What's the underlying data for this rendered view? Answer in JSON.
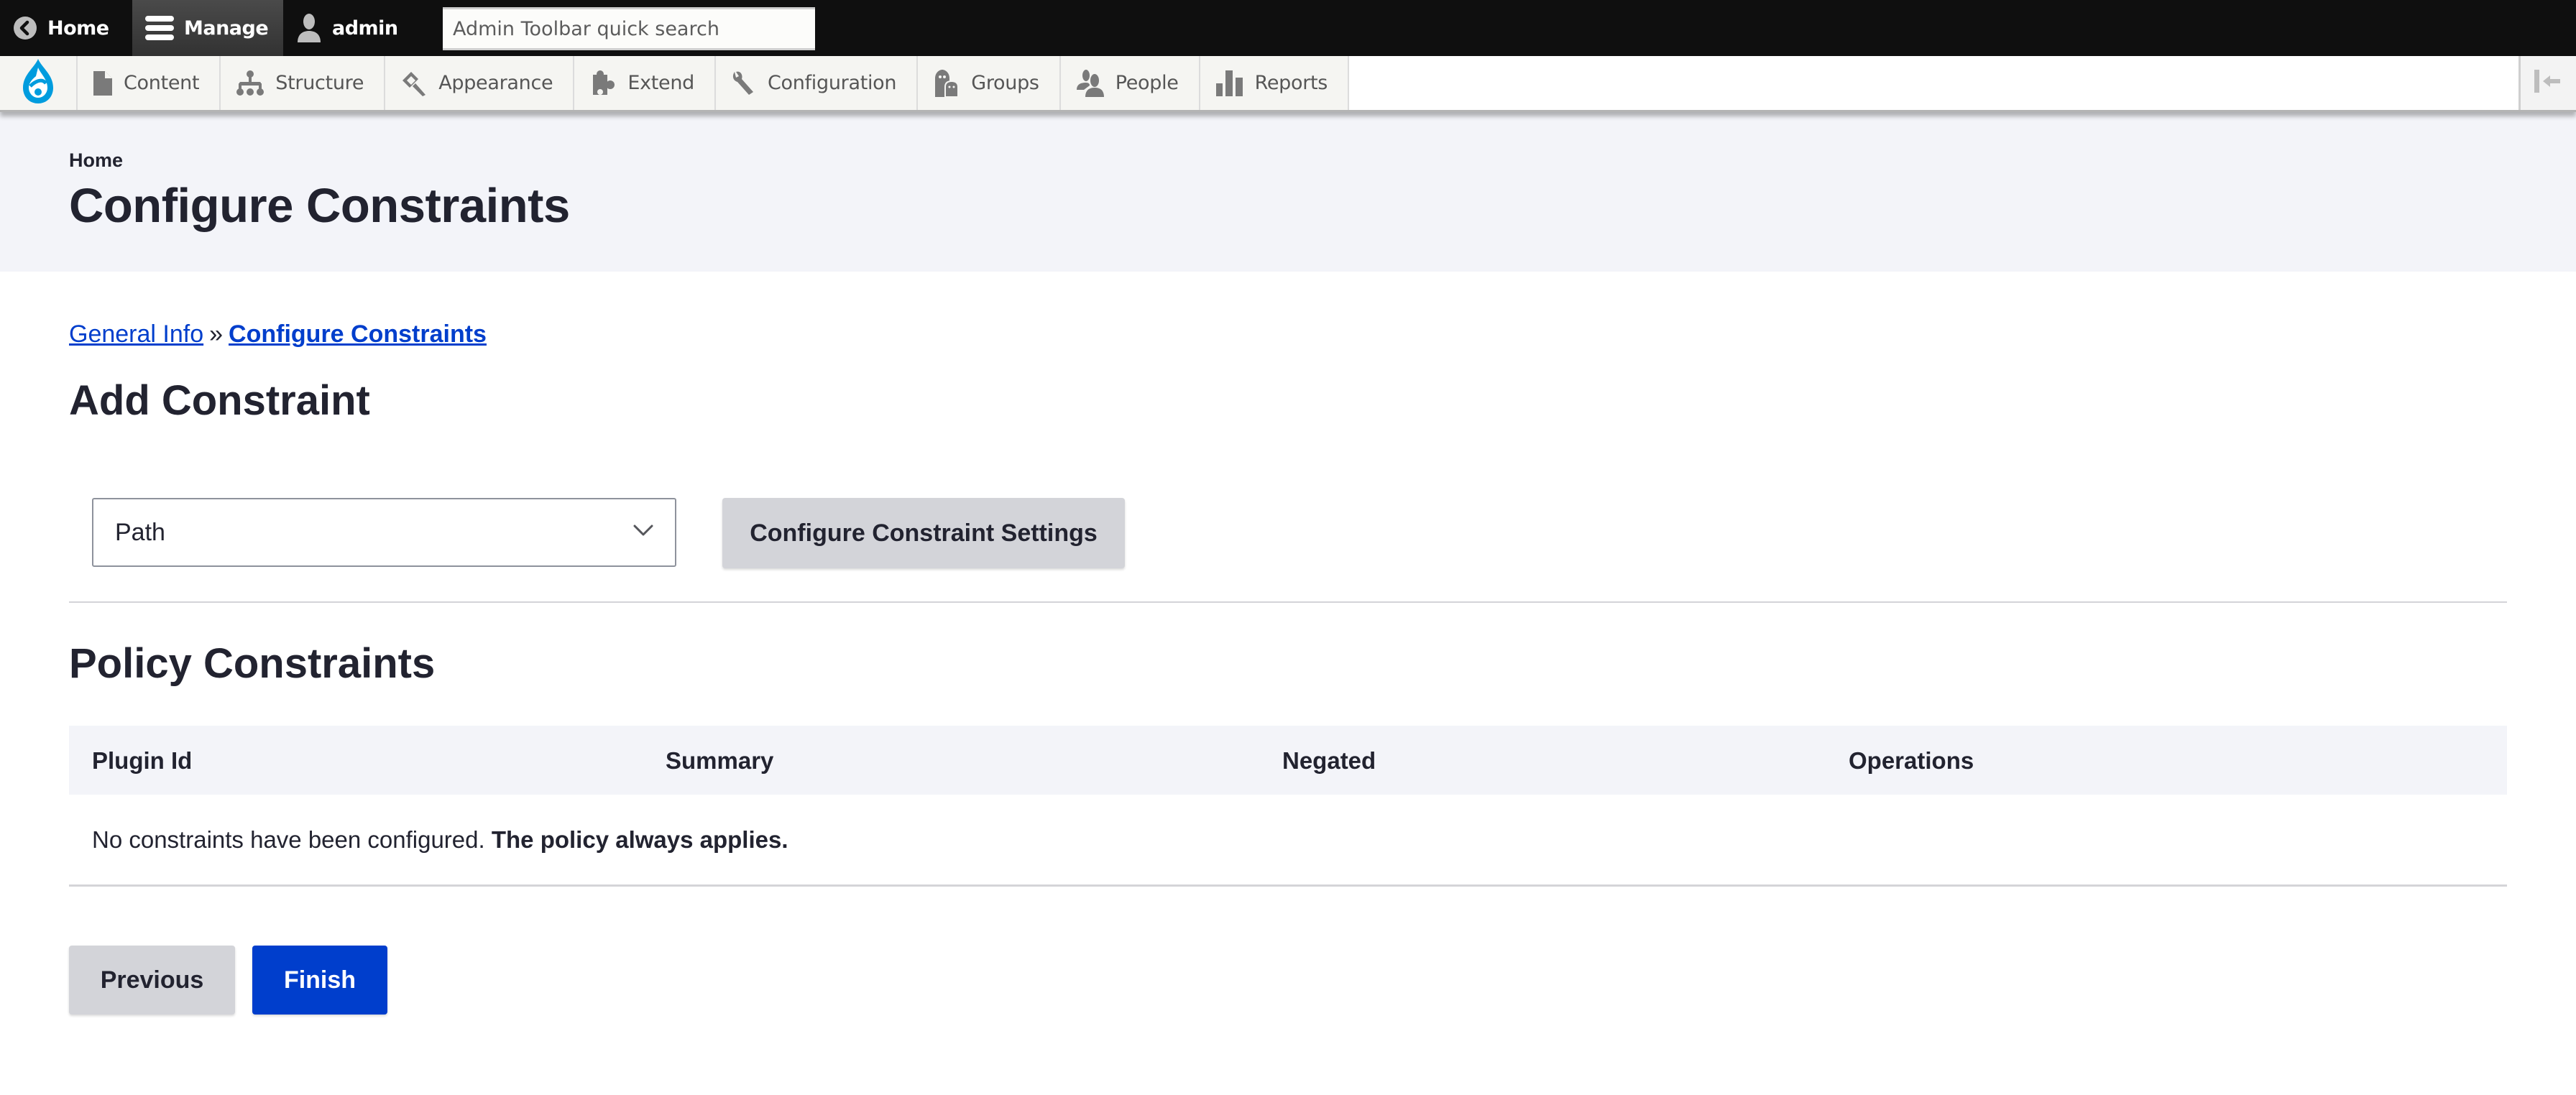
{
  "toolbar": {
    "home_label": "Home",
    "manage_label": "Manage",
    "user_label": "admin",
    "search_placeholder": "Admin Toolbar quick search",
    "search_value": "",
    "icons": {
      "home": "chevron-left-circle-icon",
      "manage": "hamburger-menu-icon",
      "user": "user-silhouette-icon"
    }
  },
  "tray": {
    "logo": "drupal-logo",
    "items": [
      {
        "label": "Content",
        "icon": "document-icon"
      },
      {
        "label": "Structure",
        "icon": "sitemap-icon"
      },
      {
        "label": "Appearance",
        "icon": "paintbrush-icon"
      },
      {
        "label": "Extend",
        "icon": "puzzle-piece-icon"
      },
      {
        "label": "Configuration",
        "icon": "wrench-icon"
      },
      {
        "label": "Groups",
        "icon": "groups-icon"
      },
      {
        "label": "People",
        "icon": "people-icon"
      },
      {
        "label": "Reports",
        "icon": "bar-chart-icon"
      }
    ],
    "collapse_icon": "collapse-left-icon"
  },
  "header": {
    "breadcrumb_home": "Home",
    "title": "Configure Constraints"
  },
  "wizard": {
    "steps": [
      {
        "label": "General Info",
        "current": false
      },
      {
        "label": "Configure Constraints",
        "current": true
      }
    ],
    "separator": "»"
  },
  "add_constraint": {
    "heading": "Add Constraint",
    "select_value": "Path",
    "select_options": [
      "Path"
    ],
    "configure_button": "Configure Constraint Settings"
  },
  "policy_constraints": {
    "heading": "Policy Constraints",
    "columns": [
      "Plugin Id",
      "Summary",
      "Negated",
      "Operations"
    ],
    "rows": [],
    "empty_message": "No constraints have been configured.",
    "empty_message_strong": "The policy always applies."
  },
  "actions": {
    "previous_label": "Previous",
    "finish_label": "Finish"
  },
  "colors": {
    "primary": "#003ecc",
    "link": "#003ecc",
    "header_bg": "#f3f4f9",
    "toolbar_bg": "#0f0f0f",
    "drupal_blue": "#009cde"
  }
}
